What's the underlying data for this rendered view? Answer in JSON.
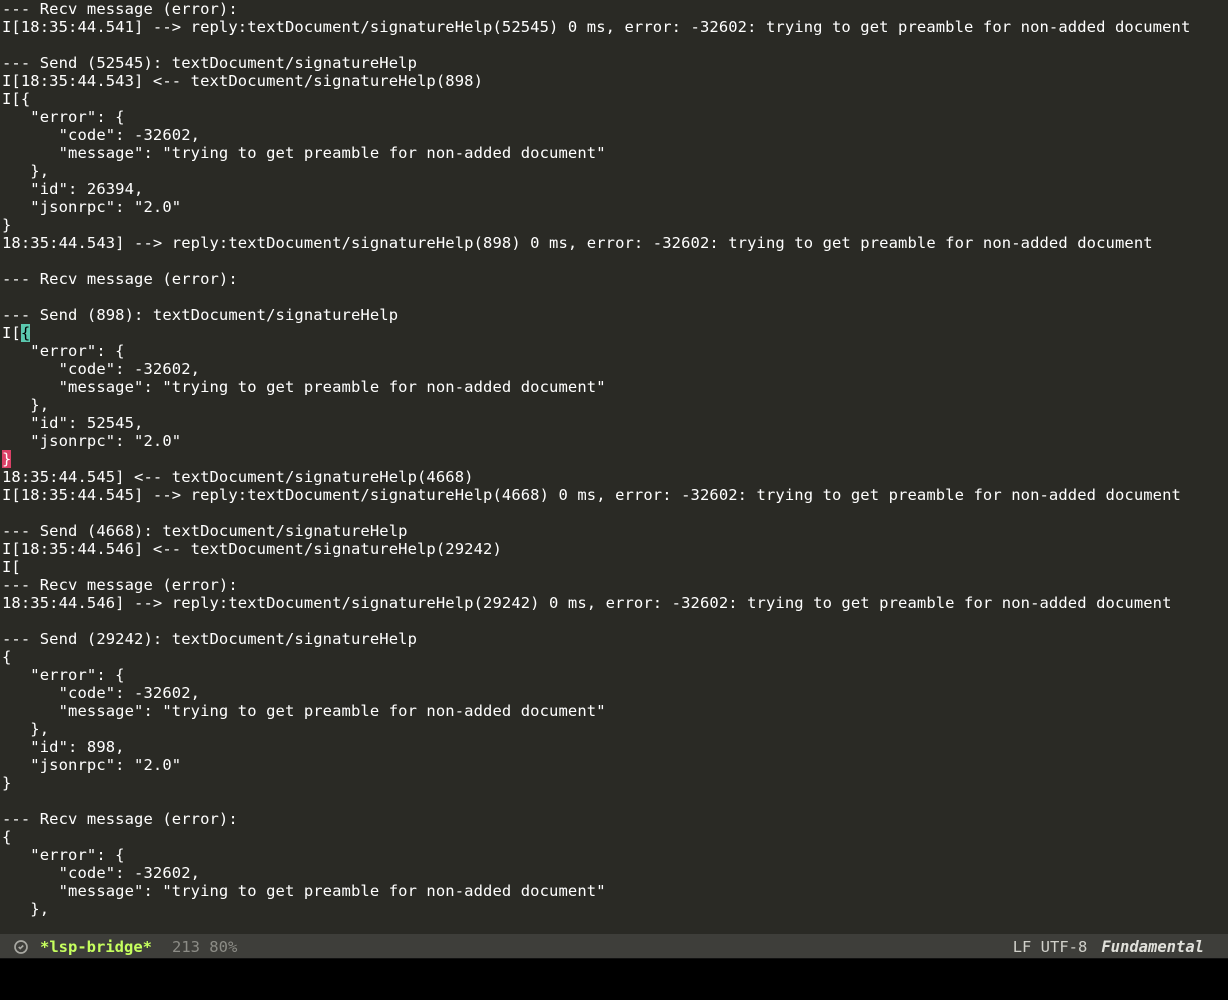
{
  "lines_before_cursor": "--- Recv message (error):\nI[18:35:44.541] --> reply:textDocument/signatureHelp(52545) 0 ms, error: -32602: trying to get preamble for non-added document\n\n--- Send (52545): textDocument/signatureHelp\nI[18:35:44.543] <-- textDocument/signatureHelp(898)\nI[{\n   \"error\": {\n      \"code\": -32602,\n      \"message\": \"trying to get preamble for non-added document\"\n   },\n   \"id\": 26394,\n   \"jsonrpc\": \"2.0\"\n}\n18:35:44.543] --> reply:textDocument/signatureHelp(898) 0 ms, error: -32602: trying to get preamble for non-added document\n\n--- Recv message (error):\n\n--- Send (898): textDocument/signatureHelp\nI[",
  "cursor_char": "{",
  "lines_mid": "\n   \"error\": {\n      \"code\": -32602,\n      \"message\": \"trying to get preamble for non-added document\"\n   },\n   \"id\": 52545,\n   \"jsonrpc\": \"2.0\"\n",
  "match_char": "}",
  "lines_after_cursor": "\n18:35:44.545] <-- textDocument/signatureHelp(4668)\nI[18:35:44.545] --> reply:textDocument/signatureHelp(4668) 0 ms, error: -32602: trying to get preamble for non-added document\n\n--- Send (4668): textDocument/signatureHelp\nI[18:35:44.546] <-- textDocument/signatureHelp(29242)\nI[\n--- Recv message (error):\n18:35:44.546] --> reply:textDocument/signatureHelp(29242) 0 ms, error: -32602: trying to get preamble for non-added document\n\n--- Send (29242): textDocument/signatureHelp\n{\n   \"error\": {\n      \"code\": -32602,\n      \"message\": \"trying to get preamble for non-added document\"\n   },\n   \"id\": 898,\n   \"jsonrpc\": \"2.0\"\n}\n\n--- Recv message (error):\n{\n   \"error\": {\n      \"code\": -32602,\n      \"message\": \"trying to get preamble for non-added document\"\n   },",
  "modeline": {
    "buffer_name": "*lsp-bridge*",
    "position": "213 80%",
    "encoding": "LF UTF-8",
    "major_mode": "Fundamental"
  }
}
